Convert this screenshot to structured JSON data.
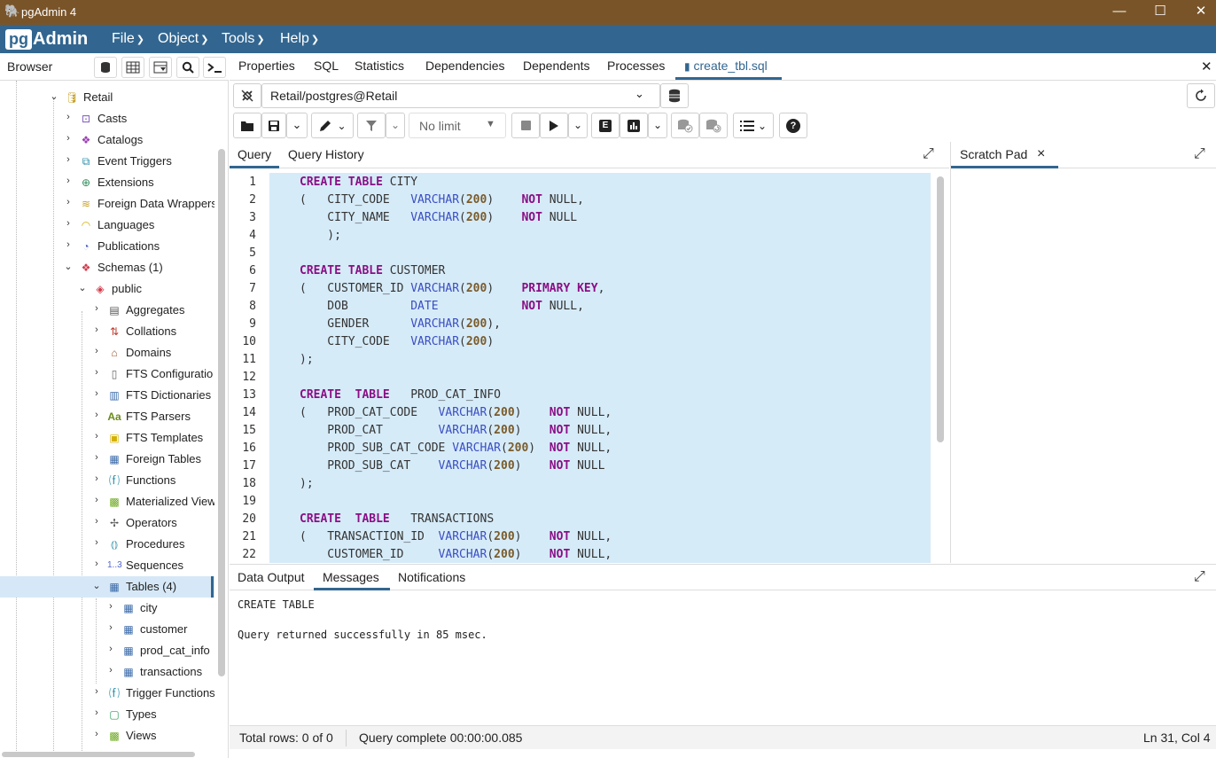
{
  "window": {
    "title": "pgAdmin 4",
    "minimize": "—",
    "maximize": "☐",
    "close": "✕"
  },
  "menubar": {
    "logo_pg": "pg",
    "logo_admin": "Admin",
    "items": [
      "File",
      "Object",
      "Tools",
      "Help"
    ]
  },
  "browser": {
    "label": "Browser",
    "tree": [
      {
        "label": "Retail",
        "icon": "database-icon"
      },
      {
        "label": "Casts",
        "icon": "casts-icon"
      },
      {
        "label": "Catalogs",
        "icon": "catalogs-icon"
      },
      {
        "label": "Event Triggers",
        "icon": "event-triggers-icon"
      },
      {
        "label": "Extensions",
        "icon": "extensions-icon"
      },
      {
        "label": "Foreign Data Wrappers",
        "icon": "foreign-data-wrappers-icon"
      },
      {
        "label": "Languages",
        "icon": "languages-icon"
      },
      {
        "label": "Publications",
        "icon": "publications-icon"
      },
      {
        "label": "Schemas (1)",
        "icon": "schemas-icon"
      },
      {
        "label": "public",
        "icon": "schema-icon"
      },
      {
        "label": "Aggregates",
        "icon": "aggregates-icon"
      },
      {
        "label": "Collations",
        "icon": "collations-icon"
      },
      {
        "label": "Domains",
        "icon": "domains-icon"
      },
      {
        "label": "FTS Configuratio",
        "icon": "fts-configurations-icon"
      },
      {
        "label": "FTS Dictionaries",
        "icon": "fts-dictionaries-icon"
      },
      {
        "label": "FTS Parsers",
        "icon": "fts-parsers-icon"
      },
      {
        "label": "FTS Templates",
        "icon": "fts-templates-icon"
      },
      {
        "label": "Foreign Tables",
        "icon": "foreign-tables-icon"
      },
      {
        "label": "Functions",
        "icon": "functions-icon"
      },
      {
        "label": "Materialized View",
        "icon": "materialized-views-icon"
      },
      {
        "label": "Operators",
        "icon": "operators-icon"
      },
      {
        "label": "Procedures",
        "icon": "procedures-icon"
      },
      {
        "label": "Sequences",
        "icon": "sequences-icon"
      },
      {
        "label": "Tables (4)",
        "icon": "tables-icon"
      },
      {
        "label": "city",
        "icon": "table-icon"
      },
      {
        "label": "customer",
        "icon": "table-icon"
      },
      {
        "label": "prod_cat_info",
        "icon": "table-icon"
      },
      {
        "label": "transactions",
        "icon": "table-icon"
      },
      {
        "label": "Trigger Functions",
        "icon": "trigger-functions-icon"
      },
      {
        "label": "Types",
        "icon": "types-icon"
      },
      {
        "label": "Views",
        "icon": "views-icon"
      }
    ]
  },
  "tabs": [
    "Properties",
    "SQL",
    "Statistics",
    "Dependencies",
    "Dependents",
    "Processes",
    "create_tbl.sql"
  ],
  "connection": {
    "value": "Retail/postgres@Retail"
  },
  "toolbar": {
    "limit": "No limit"
  },
  "editor_tabs": [
    "Query",
    "Query History"
  ],
  "scratch_pad": {
    "label": "Scratch Pad",
    "close": "×"
  },
  "editor": {
    "lines": [
      "1",
      "2",
      "3",
      "4",
      "5",
      "6",
      "7",
      "8",
      "9",
      "10",
      "11",
      "12",
      "13",
      "14",
      "15",
      "16",
      "17",
      "18",
      "19",
      "20",
      "21",
      "22"
    ]
  },
  "output": {
    "tabs": [
      "Data Output",
      "Messages",
      "Notifications"
    ],
    "messages": [
      "CREATE TABLE",
      "Query returned successfully in 85 msec."
    ]
  },
  "status": {
    "rows": "Total rows: 0 of 0",
    "query": "Query complete 00:00:00.085",
    "position": "Ln 31, Col 4"
  },
  "colors": {
    "titlebar": "#7a5429",
    "menubar": "#326690",
    "selection": "#d6ebf8",
    "keyword": "#8a0f85",
    "type": "#3a4ec2"
  }
}
